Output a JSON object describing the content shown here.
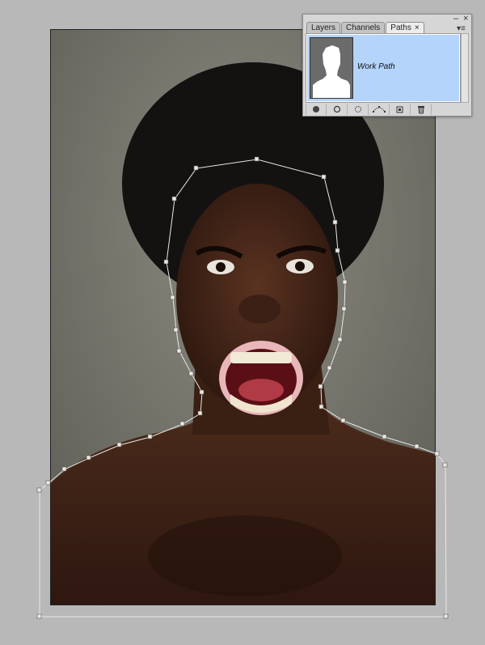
{
  "panel": {
    "tabs": [
      {
        "label": "Layers",
        "active": false
      },
      {
        "label": "Channels",
        "active": false
      },
      {
        "label": "Paths",
        "active": true
      }
    ],
    "tab_close_glyph": "×",
    "minimize_glyph": "‒",
    "close_glyph": "×",
    "menu_glyph": "▾≡",
    "selected_path": {
      "name": "Work Path"
    },
    "buttons": [
      {
        "icon": "fill-path-icon"
      },
      {
        "icon": "stroke-path-icon"
      },
      {
        "icon": "load-selection-icon"
      },
      {
        "icon": "make-work-path-icon"
      },
      {
        "icon": "new-path-icon"
      },
      {
        "icon": "delete-path-icon"
      }
    ],
    "colors": {
      "selection": "#b4d4fb",
      "panel_bg": "#d6d6d6"
    }
  },
  "canvas": {
    "background": "#b8b8b8",
    "image_subject": "photo"
  }
}
